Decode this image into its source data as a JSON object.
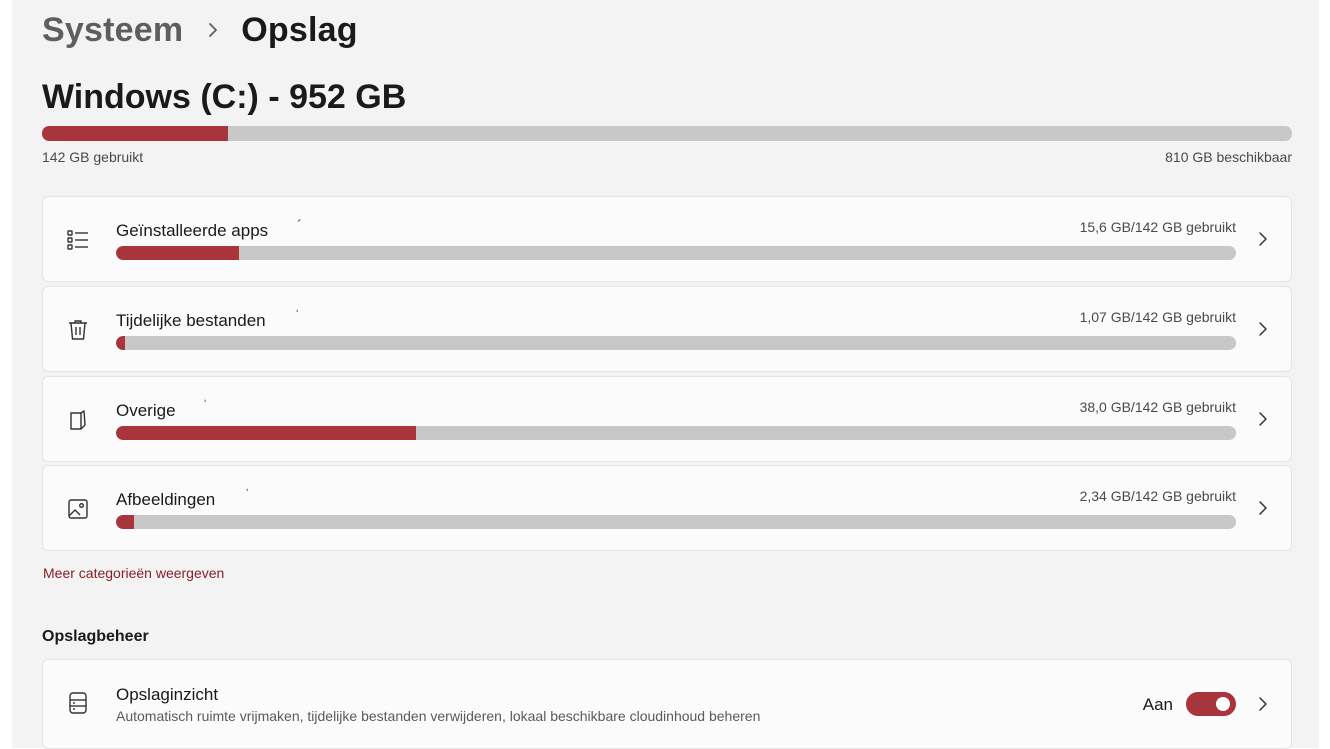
{
  "breadcrumb": {
    "parent": "Systeem",
    "current": "Opslag"
  },
  "drive": {
    "title": "Windows (C:) - 952 GB",
    "used_label": "142 GB gebruikt",
    "free_label": "810 GB beschikbaar",
    "used_fraction": 0.149
  },
  "categories": [
    {
      "label": "Geïnstalleerde apps",
      "usage": "15,6 GB/142 GB gebruikt",
      "fraction": 0.11,
      "icon": "list-icon"
    },
    {
      "label": "Tijdelijke bestanden",
      "usage": "1,07 GB/142 GB gebruikt",
      "fraction": 0.008,
      "icon": "trash-icon"
    },
    {
      "label": "Overige",
      "usage": "38,0 GB/142 GB gebruikt",
      "fraction": 0.268,
      "icon": "document-icon"
    },
    {
      "label": "Afbeeldingen",
      "usage": "2,34 GB/142 GB gebruikt",
      "fraction": 0.016,
      "icon": "image-icon"
    }
  ],
  "more_link": "Meer categorieën weergeven",
  "management": {
    "section_title": "Opslagbeheer",
    "storage_sense": {
      "title": "Opslaginzicht",
      "description": "Automatisch ruimte vrijmaken, tijdelijke bestanden verwijderen, lokaal beschikbare cloudinhoud beheren",
      "toggle_label": "Aan",
      "toggle_on": true
    }
  },
  "colors": {
    "accent": "#a8353c",
    "track": "#c8c8c8",
    "link": "#8a1f26"
  }
}
